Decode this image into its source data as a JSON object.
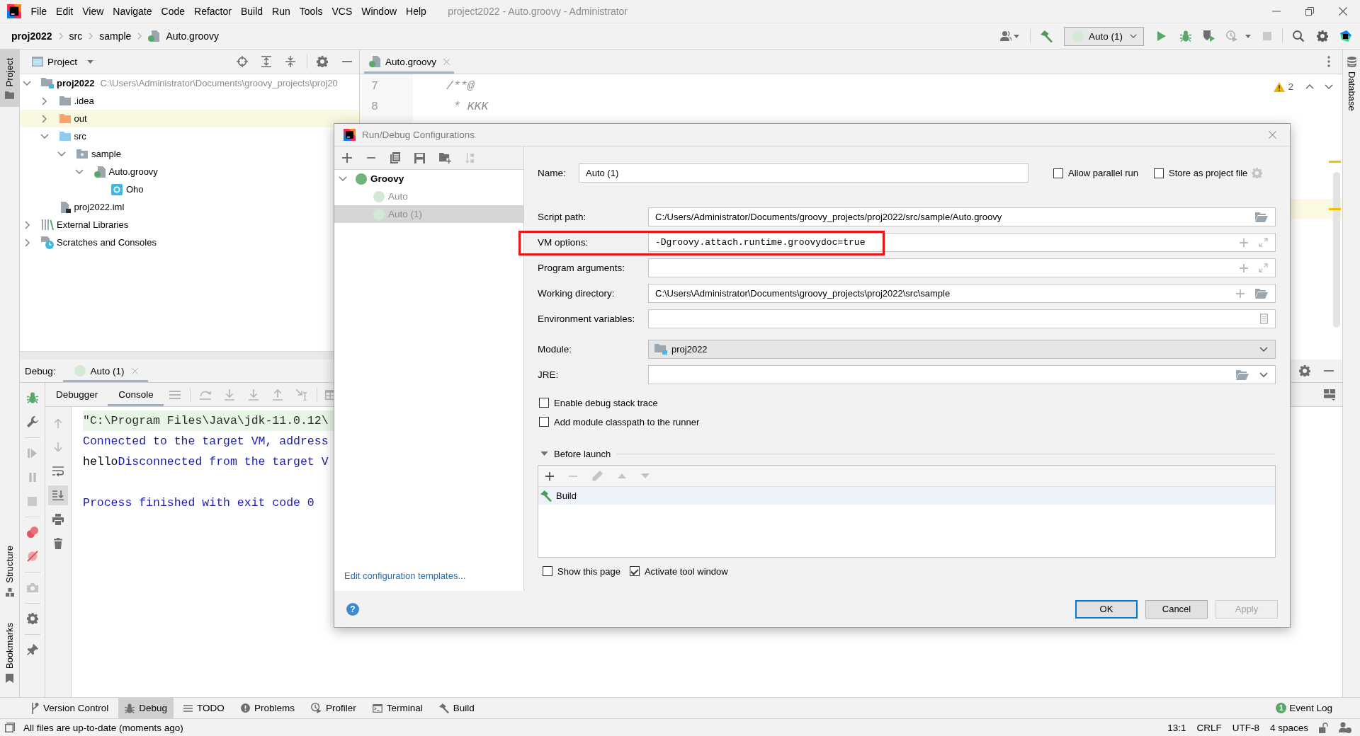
{
  "window": {
    "menu": [
      "File",
      "Edit",
      "View",
      "Navigate",
      "Code",
      "Refactor",
      "Build",
      "Run",
      "Tools",
      "VCS",
      "Window",
      "Help"
    ],
    "title": "project2022 - Auto.groovy - Administrator"
  },
  "navigation_bar": {
    "breadcrumbs": [
      {
        "label": "proj2022",
        "kind": "project"
      },
      {
        "label": "src",
        "kind": "folder"
      },
      {
        "label": "sample",
        "kind": "folder"
      },
      {
        "label": "Auto.groovy",
        "kind": "file"
      }
    ],
    "run_configuration": "Auto (1)"
  },
  "left_stripe": {
    "top": [
      {
        "label": "Project",
        "kind": "project",
        "selected": true
      }
    ],
    "bottom": [
      {
        "label": "Structure",
        "kind": "structure",
        "selected": false
      },
      {
        "label": "Bookmarks",
        "kind": "bookmarks",
        "selected": false
      }
    ]
  },
  "project_panel": {
    "title": "Project",
    "tree": [
      {
        "label": "proj2022",
        "path": "C:\\Users\\Administrator\\Documents\\groovy_projects\\proj20",
        "kind": "module",
        "expanded": true,
        "children": [
          {
            "label": ".idea",
            "kind": "folder",
            "expanded": false
          },
          {
            "label": "out",
            "kind": "excluded-folder",
            "expanded": false
          },
          {
            "label": "src",
            "kind": "source-folder",
            "expanded": true,
            "children": [
              {
                "label": "sample",
                "kind": "package",
                "expanded": true,
                "children": [
                  {
                    "label": "Auto.groovy",
                    "kind": "groovy-file",
                    "expanded": true,
                    "children": [
                      {
                        "label": "Oho",
                        "kind": "class"
                      }
                    ]
                  }
                ]
              }
            ]
          },
          {
            "label": "proj2022.iml",
            "kind": "module-file"
          }
        ]
      },
      {
        "label": "External Libraries",
        "kind": "libraries",
        "expanded": false
      },
      {
        "label": "Scratches and Consoles",
        "kind": "scratches",
        "expanded": false
      }
    ]
  },
  "editor": {
    "tabs": [
      {
        "label": "Auto.groovy",
        "selected": true
      }
    ],
    "lines": [
      {
        "number": "7",
        "text": "/**@"
      },
      {
        "number": "8",
        "text": " * KKK"
      }
    ],
    "warning_count": "2"
  },
  "right_stripe": [
    {
      "label": "Database",
      "kind": "database",
      "selected": false
    }
  ],
  "debug_panel": {
    "label": "Debug:",
    "sessions": [
      {
        "label": "Auto (1)",
        "selected": true
      }
    ],
    "tabs": [
      {
        "label": "Debugger",
        "selected": false
      },
      {
        "label": "Console",
        "selected": true
      }
    ],
    "scroll_to_end": true,
    "console": [
      {
        "kind": "command",
        "segments": [
          {
            "text": "\"C:\\Program Files\\Java\\jdk-11.0.12\\",
            "kind": "command"
          }
        ]
      },
      {
        "kind": "plain",
        "segments": [
          {
            "text": "Connected to the target VM, address",
            "kind": "system"
          }
        ]
      },
      {
        "kind": "plain",
        "segments": [
          {
            "text": "hello",
            "kind": "output"
          },
          {
            "text": "Disconnected from the target V",
            "kind": "system"
          }
        ]
      },
      {
        "kind": "exit",
        "segments": [
          {
            "text": "Process finished with exit code 0",
            "kind": "system"
          }
        ]
      }
    ]
  },
  "tool_window_bar": {
    "buttons": [
      {
        "label": "Version Control",
        "kind": "vcs",
        "selected": false
      },
      {
        "label": "Debug",
        "kind": "debug",
        "selected": true
      },
      {
        "label": "TODO",
        "kind": "todo",
        "selected": false
      },
      {
        "label": "Problems",
        "kind": "problems",
        "selected": false
      },
      {
        "label": "Profiler",
        "kind": "profiler",
        "selected": false
      },
      {
        "label": "Terminal",
        "kind": "terminal",
        "selected": false
      },
      {
        "label": "Build",
        "kind": "build",
        "selected": false
      }
    ],
    "event_log": {
      "label": "Event Log",
      "count": "1"
    }
  },
  "status_bar": {
    "message": "All files are up-to-date (moments ago)",
    "items": [
      "13:1",
      "CRLF",
      "UTF-8",
      "4 spaces"
    ]
  },
  "dialog": {
    "title": "Run/Debug Configurations",
    "tree": [
      {
        "label": "Groovy",
        "selected": false,
        "temporary": false,
        "expanded": true,
        "children": [
          {
            "label": "Auto",
            "selected": false,
            "temporary": true
          },
          {
            "label": "Auto (1)",
            "selected": true,
            "temporary": true
          }
        ]
      }
    ],
    "templates_link": "Edit configuration templates...",
    "name": {
      "label": "Name:",
      "value": "Auto (1)"
    },
    "header_options": [
      {
        "label": "Allow parallel run",
        "checked": false
      },
      {
        "label": "Store as project file",
        "checked": false
      }
    ],
    "fields": [
      {
        "label": "Script path:",
        "value": "C:/Users/Administrator/Documents/groovy_projects/proj2022/src/sample/Auto.groovy",
        "kind": "file",
        "highlighted": false
      },
      {
        "label": "VM options:",
        "value": "-Dgroovy.attach.runtime.groovydoc=true",
        "kind": "expandable",
        "highlighted": true
      },
      {
        "label": "Program arguments:",
        "kind": "expandable",
        "highlighted": false
      },
      {
        "label": "Working directory:",
        "value": "C:\\Users\\Administrator\\Documents\\groovy_projects\\proj2022\\src\\sample",
        "kind": "directory",
        "highlighted": false
      },
      {
        "label": "Environment variables:",
        "kind": "environment",
        "highlighted": false
      },
      {
        "label": "Module:",
        "value": "proj2022",
        "kind": "module",
        "highlighted": false
      },
      {
        "label": "JRE:",
        "kind": "jre",
        "highlighted": false
      }
    ],
    "options": [
      {
        "label": "Enable debug stack trace",
        "checked": false
      },
      {
        "label": "Add module classpath to the runner",
        "checked": false
      }
    ],
    "before_launch": {
      "title": "Before launch",
      "expanded": true,
      "tasks": [
        {
          "label": "Build",
          "selected": true
        }
      ]
    },
    "footer_options": [
      {
        "label": "Show this page",
        "checked": false
      },
      {
        "label": "Activate tool window",
        "checked": true
      }
    ],
    "help": "?",
    "buttons": [
      {
        "label": "OK",
        "default": true,
        "disabled": false
      },
      {
        "label": "Cancel",
        "default": false,
        "disabled": false
      },
      {
        "label": "Apply",
        "default": false,
        "disabled": true
      }
    ]
  }
}
